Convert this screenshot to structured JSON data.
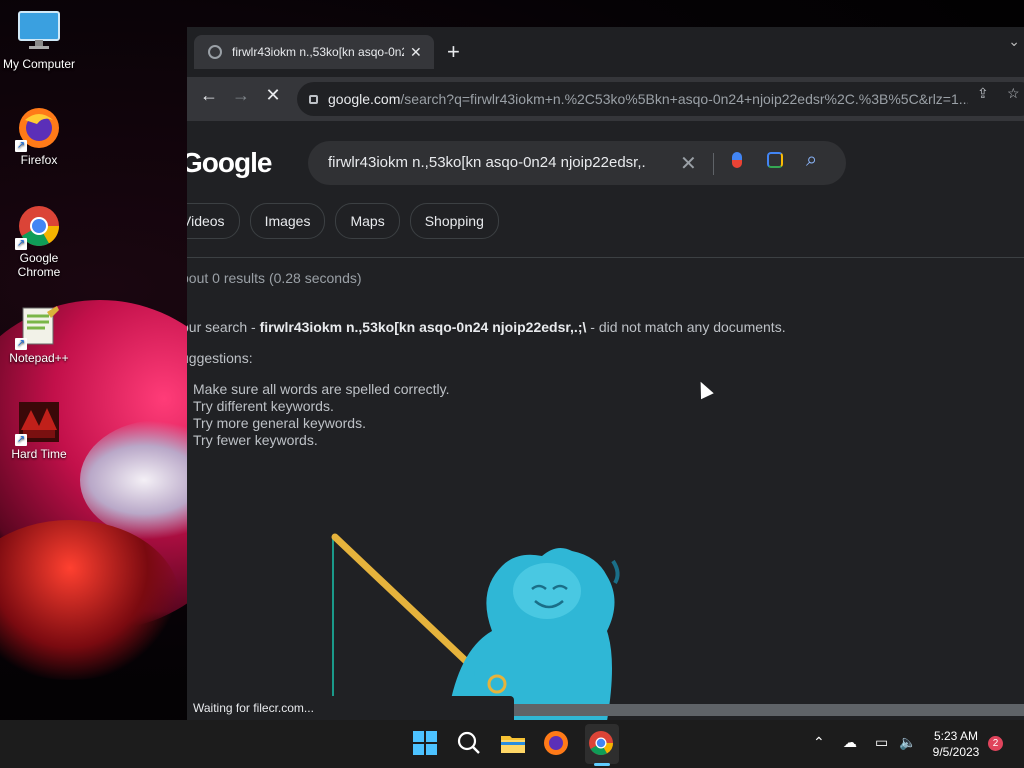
{
  "desktop": {
    "icons": [
      {
        "label": "My Computer",
        "icon": "monitor-icon"
      },
      {
        "label": "Firefox",
        "icon": "firefox-icon"
      },
      {
        "label": "Google Chrome",
        "icon": "chrome-icon"
      },
      {
        "label": "Notepad++",
        "icon": "notepadpp-icon"
      },
      {
        "label": "Hard Time",
        "icon": "hard-time-icon"
      }
    ]
  },
  "browser": {
    "tab_title": "firwlr43iokm n.,53ko[kn asqo-0n24",
    "url_host": "google.com",
    "url_path": "/search?q=firwlr43iokm+n.%2C53ko%5Bkn+asqo-0n24+njoip22edsr%2C.%3B%5C&rlz=1...",
    "status_text": "Waiting for filecr.com..."
  },
  "search": {
    "logo": "Google",
    "query": "firwlr43iokm n.,53ko[kn asqo-0n24 njoip22edsr,.",
    "chips": [
      "Videos",
      "Images",
      "Maps",
      "Shopping"
    ],
    "stats": "bout 0 results (0.28 seconds)",
    "nomatch_prefix": "our search - ",
    "nomatch_query": "firwlr43iokm n.,53ko[kn asqo-0n24 njoip22edsr,.;\\",
    "nomatch_suffix": " - did not match any documents.",
    "suggestions_heading": "uggestions:",
    "suggestions": [
      "Make sure all words are spelled correctly.",
      "Try different keywords.",
      "Try more general keywords.",
      "Try fewer keywords."
    ]
  },
  "taskbar": {
    "time": "5:23 AM",
    "date": "9/5/2023",
    "notification_count": "2"
  },
  "colors": {
    "page_bg": "#202124",
    "link_blue": "#8ab4f8",
    "taskbar_bg": "#1c1c1c"
  }
}
